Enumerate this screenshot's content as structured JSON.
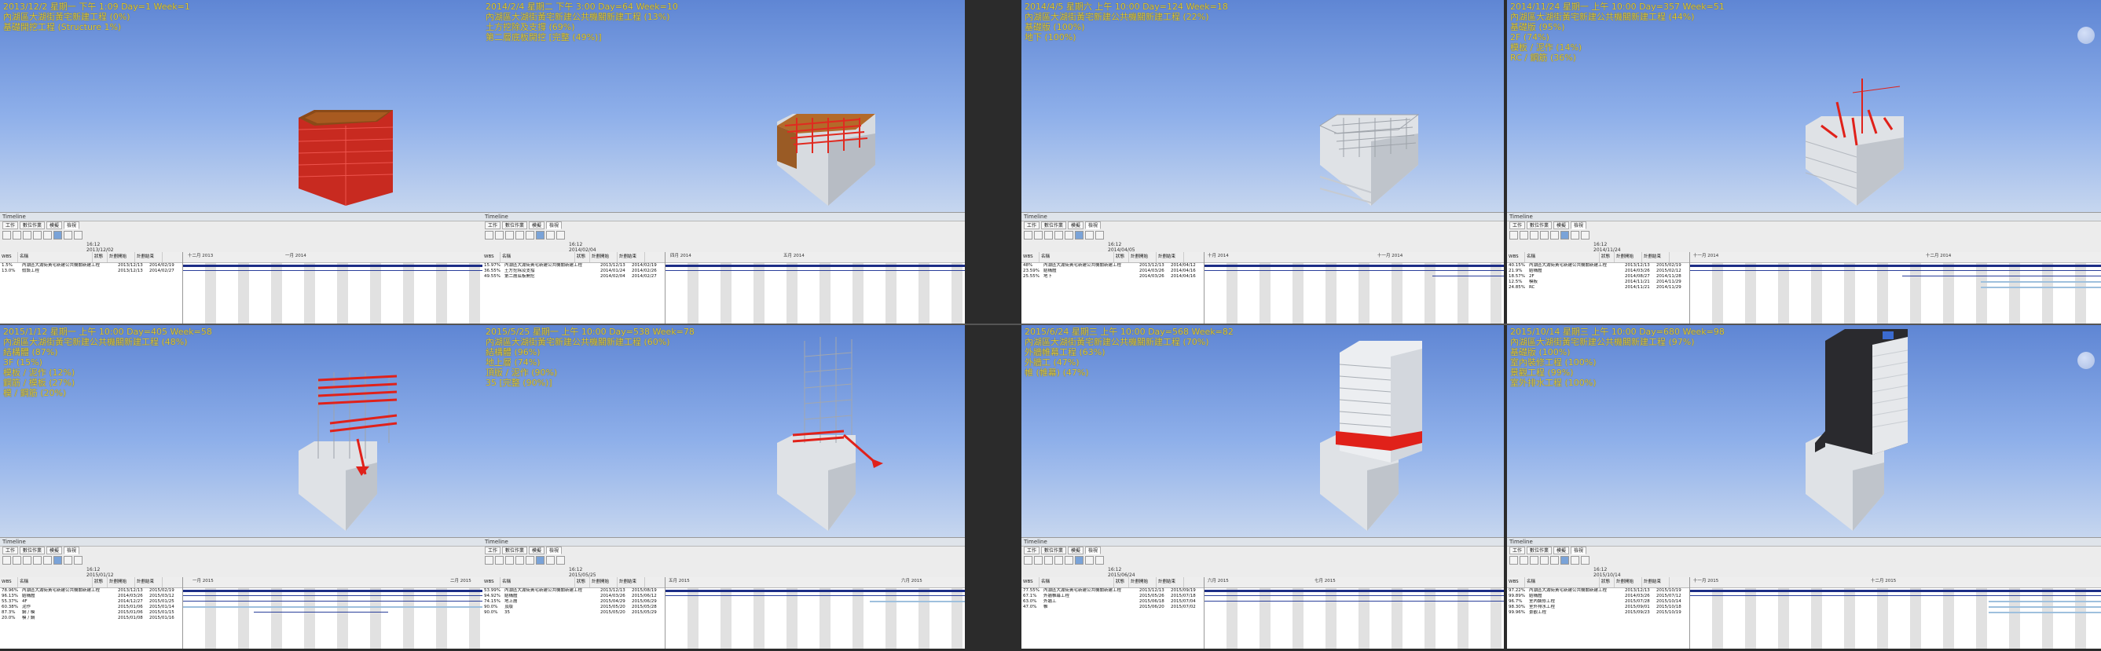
{
  "panels": [
    {
      "caption": [
        "2013/12/2 星期一 下午 1:09 Day=1 Week=1",
        "內湖區大湖街黃宅新建工程 (0%)",
        "基礎開挖工程 (Structure 1%)"
      ],
      "timeline": {
        "title": "Timeline",
        "tabs": [
          "工作",
          "數位作業",
          "模擬",
          "檢視"
        ],
        "date": [
          "16:12",
          "2013/12/02"
        ],
        "rows": [
          [
            "1.5%",
            "內湖區大湖街黃宅新建公共機關新建工程",
            "2013/12/13",
            "2014/02/19"
          ],
          [
            "13.0%",
            "假設工程",
            "2013/12/13",
            "2014/02/27"
          ]
        ],
        "months": [
          "十二月 2013",
          "一月 2014"
        ]
      }
    },
    {
      "caption": [
        "2014/2/4 星期二 下午 3:00 Day=64 Week=10",
        "內湖區大湖街黃宅新建公共機關新建工程 (13%)",
        "土方挖除及支撐 (69%)",
        "第二層底板開挖 [完整 (49%)]"
      ],
      "timeline": {
        "title": "Timeline",
        "tabs": [
          "工作",
          "數位作業",
          "模擬",
          "檢視"
        ],
        "date": [
          "16:12",
          "2014/02/04"
        ],
        "rows": [
          [
            "15.97%",
            "內湖區大湖街黃宅新建公共機關新建工程",
            "2013/12/13",
            "2014/02/19"
          ],
          [
            "36.55%",
            "土方挖除及支撐",
            "2014/01/24",
            "2014/02/26"
          ],
          [
            "49.55%",
            "第二層底板開挖",
            "2014/02/04",
            "2014/02/27"
          ]
        ],
        "months": [
          "四月 2014",
          "五月 2014"
        ]
      }
    },
    {
      "caption": [
        "2014/4/5 星期六 上午 10:00 Day=124 Week=18",
        "內湖區大湖街黃宅新建公共機關新建工程 (22%)",
        "基礎版 (100%)",
        "地下 (100%)"
      ],
      "timeline": {
        "title": "Timeline",
        "tabs": [
          "工作",
          "數位作業",
          "模擬",
          "檢視"
        ],
        "date": [
          "16:12",
          "2014/04/05"
        ],
        "rows": [
          [
            "48%",
            "內湖區大湖街黃宅新建公共機關新建工程",
            "2013/12/13",
            "2014/04/12"
          ],
          [
            "23.59%",
            "結構體",
            "2014/03/26",
            "2014/04/16"
          ],
          [
            "25.55%",
            "地下",
            "2014/03/26",
            "2014/04/16"
          ]
        ],
        "months": [
          "十月 2014",
          "十一月 2014"
        ]
      }
    },
    {
      "caption": [
        "2014/11/24 星期一 上午 10:00 Day=357 Week=51",
        "內湖區大湖街黃宅新建公共機關新建工程 (44%)",
        "基礎版 (95%)",
        "2F (74%)",
        "模板 / 泥作 (14%)",
        "RC / 鋼筋 (36%)"
      ],
      "timeline": {
        "title": "Timeline",
        "tabs": [
          "工作",
          "數位作業",
          "模擬",
          "檢視"
        ],
        "date": [
          "16:12",
          "2014/11/24"
        ],
        "rows": [
          [
            "40.15%",
            "內湖區大湖街黃宅新建公共機關新建工程",
            "2013/12/13",
            "2015/02/19"
          ],
          [
            "21.9%",
            "結構體",
            "2014/03/26",
            "2015/02/12"
          ],
          [
            "18.57%",
            "2F",
            "2014/08/27",
            "2014/11/28"
          ],
          [
            "12.5%",
            "模板",
            "2014/11/21",
            "2014/11/29"
          ],
          [
            "24.85%",
            "RC",
            "2014/11/21",
            "2014/11/29"
          ]
        ],
        "months": [
          "十一月 2014",
          "十二月 2014"
        ]
      }
    },
    {
      "caption": [
        "2015/1/12 星期一 上午 10:00 Day=405 Week=58",
        "內湖區大湖街黃宅新建公共機關新建工程 (48%)",
        "結構體 (87%)",
        "3F (15%)",
        "模板 / 泥作 (12%)",
        "鋼筋 / 模板 (27%)",
        "模 / 鋼筋 (20%)"
      ],
      "timeline": {
        "title": "Timeline",
        "tabs": [
          "工作",
          "數位作業",
          "模擬",
          "檢視"
        ],
        "date": [
          "16:12",
          "2015/01/12"
        ],
        "rows": [
          [
            "78.96%",
            "內湖區大湖街黃宅新建公共機關新建工程",
            "2013/12/13",
            "2015/02/19"
          ],
          [
            "96.13%",
            "結構體",
            "2014/03/26",
            "2015/03/12"
          ],
          [
            "55.37%",
            "4F",
            "2014/12/27",
            "2015/01/25"
          ],
          [
            "60.38%",
            "泥作",
            "2015/01/06",
            "2015/01/14"
          ],
          [
            "87.3%",
            "鋼 / 模",
            "2015/01/06",
            "2015/01/15"
          ],
          [
            "20.0%",
            "模 / 鋼",
            "2015/01/08",
            "2015/01/16"
          ]
        ],
        "months": [
          "一月 2015",
          "二月 2015"
        ]
      }
    },
    {
      "caption": [
        "2015/5/25 星期一 上午 10:00 Day=538 Week=78",
        "內湖區大湖街黃宅新建公共機關新建工程 (60%)",
        "結構體 (96%)",
        "地上層 (74%)",
        "頂版 / 泥作 (90%)",
        "35 [完整 (90%)]"
      ],
      "timeline": {
        "title": "Timeline",
        "tabs": [
          "工作",
          "數位作業",
          "模擬",
          "檢視"
        ],
        "date": [
          "16:12",
          "2015/05/25"
        ],
        "rows": [
          [
            "53.99%",
            "內湖區大湖街黃宅新建公共機關新建工程",
            "2013/12/13",
            "2015/08/19"
          ],
          [
            "94.92%",
            "結構體",
            "2014/03/26",
            "2015/06/12"
          ],
          [
            "74.15%",
            "地上層",
            "2015/04/29",
            "2015/06/29"
          ],
          [
            "90.0%",
            "頂版",
            "2015/05/20",
            "2015/05/28"
          ],
          [
            "90.0%",
            "35",
            "2015/05/20",
            "2015/05/29"
          ]
        ],
        "months": [
          "五月 2015",
          "六月 2015"
        ]
      }
    },
    {
      "caption": [
        "2015/6/24 星期三 上午 10:00 Day=568 Week=82",
        "內湖區大湖街黃宅新建公共機關新建工程 (70%)",
        "外牆帷幕工程 (63%)",
        "外牆工 (47%)",
        "帷 (帷幕) (47%)"
      ],
      "timeline": {
        "title": "Timeline",
        "tabs": [
          "工作",
          "數位作業",
          "模擬",
          "檢視"
        ],
        "date": [
          "16:12",
          "2015/06/24"
        ],
        "rows": [
          [
            "77.55%",
            "內湖區大湖街黃宅新建公共機關新建工程",
            "2013/12/13",
            "2015/09/19"
          ],
          [
            "67.1%",
            "外牆帷幕工程",
            "2015/05/26",
            "2015/07/18"
          ],
          [
            "63.0%",
            "外牆工",
            "2015/06/18",
            "2015/07/04"
          ],
          [
            "47.0%",
            "帷",
            "2015/06/20",
            "2015/07/02"
          ]
        ],
        "months": [
          "六月 2015",
          "七月 2015"
        ]
      }
    },
    {
      "caption": [
        "2015/10/14 星期三 上午 10:00 Day=680 Week=98",
        "內湖區大湖街黃宅新建公共機關新建工程 (97%)",
        "基礎版 (100%)",
        "室內裝修工程 (100%)",
        "景觀工程 (99%)",
        "室外排水工程 (100%)"
      ],
      "timeline": {
        "title": "Timeline",
        "tabs": [
          "工作",
          "數位作業",
          "模擬",
          "檢視"
        ],
        "date": [
          "16:12",
          "2015/10/14"
        ],
        "rows": [
          [
            "97.22%",
            "內湖區大湖街黃宅新建公共機關新建工程",
            "2013/12/13",
            "2015/10/19"
          ],
          [
            "99.89%",
            "結構體",
            "2014/03/26",
            "2015/07/12"
          ],
          [
            "96.7%",
            "室內裝修工程",
            "2015/07/28",
            "2015/10/14"
          ],
          [
            "98.30%",
            "室外排水工程",
            "2015/09/01",
            "2015/10/18"
          ],
          [
            "99.96%",
            "景觀工程",
            "2015/09/23",
            "2015/10/19"
          ]
        ],
        "months": [
          "十一月 2015",
          "十二月 2015"
        ]
      }
    }
  ],
  "table_headers": [
    "WBS",
    "名稱",
    "狀態",
    "計劃開始",
    "計劃結束"
  ],
  "colors": {
    "caption": "#d9c63a",
    "bar": "#1c2d86",
    "sky_top": "#5f86d4",
    "sky_bottom": "#c6d6ef",
    "red_work": "#e0211a"
  }
}
